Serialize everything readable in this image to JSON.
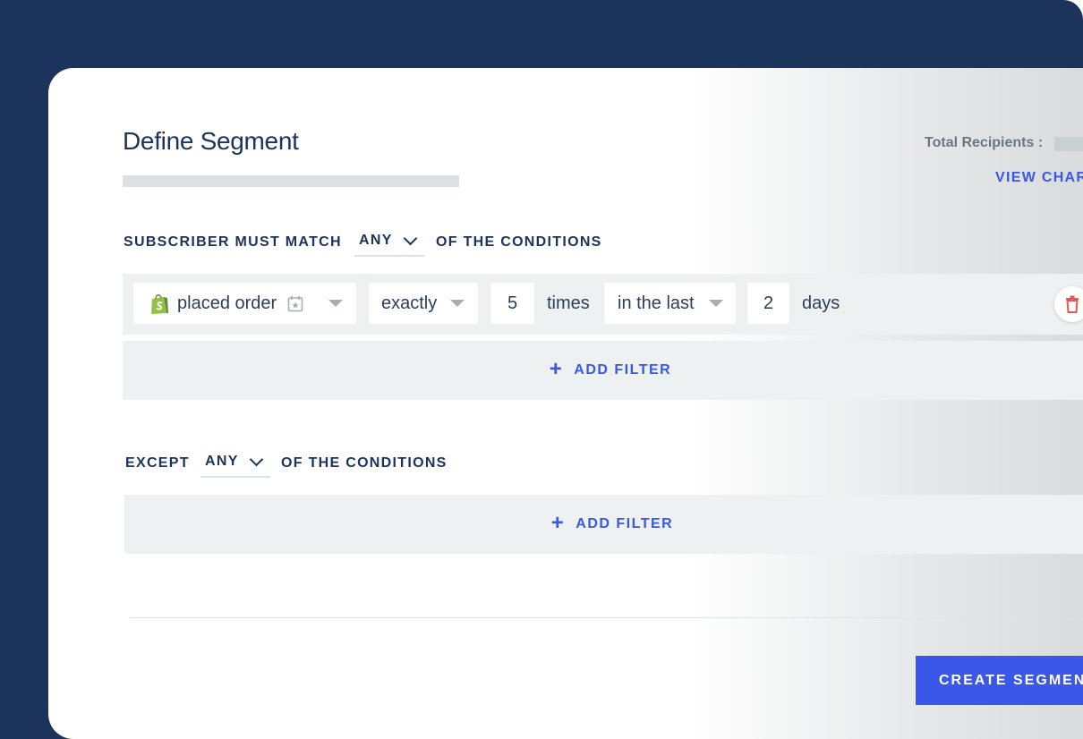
{
  "header": {
    "title": "Define Segment",
    "total_recipients_label": "Total Recipients :",
    "view_chart_label": "VIEW CHAR"
  },
  "include_section": {
    "prefix": "SUBSCRIBER MUST MATCH",
    "match_value": "ANY",
    "suffix": "OF THE CONDITIONS",
    "filters": [
      {
        "event": "placed order",
        "operator": "exactly",
        "count": "5",
        "count_unit": "times",
        "timeframe": "in the last",
        "duration": "2",
        "duration_unit": "days"
      }
    ],
    "add_filter_label": "ADD FILTER"
  },
  "exclude_section": {
    "prefix": "EXCEPT",
    "match_value": "ANY",
    "suffix": "OF THE CONDITIONS",
    "add_filter_label": "ADD FILTER"
  },
  "footer": {
    "create_label": "CREATE SEGMEN"
  },
  "colors": {
    "navy": "#1c335c",
    "accent": "#3a57e8",
    "delete": "#e05a5a",
    "shopify_green": "#95bf47"
  }
}
